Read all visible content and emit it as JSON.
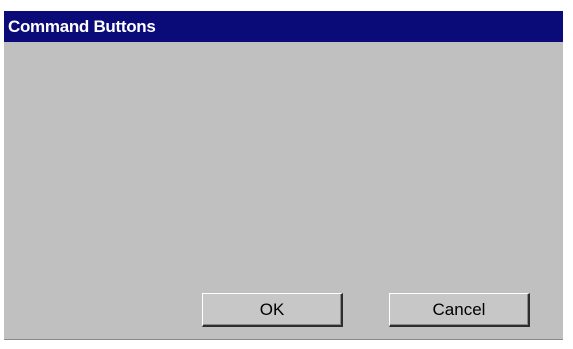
{
  "window": {
    "title": "Command Buttons"
  },
  "buttons": {
    "ok_label": "OK",
    "cancel_label": "Cancel"
  },
  "colors": {
    "title_bar": "#0a0a78",
    "dialog_background": "#c0c0c0",
    "title_text": "#ffffff"
  }
}
